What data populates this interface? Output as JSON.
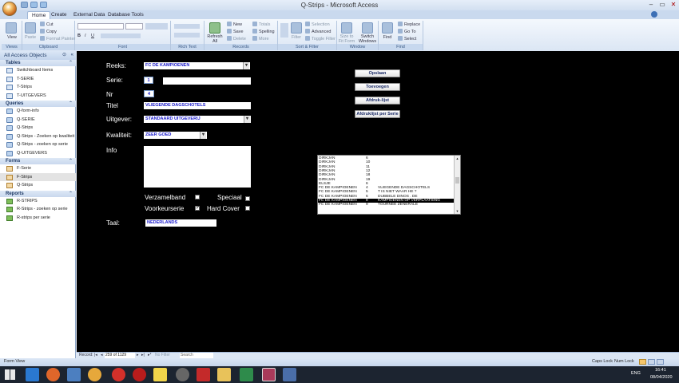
{
  "window": {
    "title": "Q-Strips - Microsoft Access",
    "controls": [
      "–",
      "▭",
      "✕"
    ]
  },
  "tabs": [
    "Home",
    "Create",
    "External Data",
    "Database Tools"
  ],
  "ribbon": {
    "groups": [
      {
        "label": "Views",
        "buttons": [
          "View"
        ]
      },
      {
        "label": "Clipboard",
        "buttons": [
          "Paste",
          "Cut",
          "Copy",
          "Format Painter"
        ]
      },
      {
        "label": "Font",
        "buttons": []
      },
      {
        "label": "Rich Text",
        "buttons": []
      },
      {
        "label": "Records",
        "buttons": [
          "Refresh All",
          "New",
          "Save",
          "Delete",
          "Totals",
          "Spelling",
          "More"
        ]
      },
      {
        "label": "Sort & Filter",
        "buttons": [
          "Filter",
          "Selection",
          "Advanced",
          "Toggle Filter"
        ]
      },
      {
        "label": "Window",
        "buttons": [
          "Size to Fit Form",
          "Switch Windows"
        ]
      },
      {
        "label": "Find",
        "buttons": [
          "Find",
          "Replace",
          "Go To",
          "Select"
        ]
      }
    ]
  },
  "nav": {
    "header": "All Access Objects",
    "sections": [
      {
        "title": "Tables",
        "type": "table",
        "items": [
          "Switchboard Items",
          "T-SERIE",
          "T-Strips",
          "T-UITGEVERS"
        ]
      },
      {
        "title": "Queries",
        "type": "query",
        "items": [
          "Q-form-info",
          "Q-SERIE",
          "Q-Strips",
          "Q-Strips - Zoeken op kwaliteit",
          "Q-Strips - zoeken op serie",
          "Q-UITGEVERS"
        ]
      },
      {
        "title": "Forms",
        "type": "form",
        "items": [
          "F-Serie",
          "F-Strips",
          "Q-Strips"
        ]
      },
      {
        "title": "Reports",
        "type": "report",
        "items": [
          "R-STRIPS",
          "R-Strips - zoeken op serie",
          "R-strips per serie"
        ]
      }
    ],
    "selected": "F-Strips"
  },
  "form": {
    "labels": {
      "reeks": "Reeks:",
      "serie": "Serie:",
      "nr": "Nr",
      "titel": "Titel",
      "uitgever": "Uitgever:",
      "kwaliteit": "Kwaliteit:",
      "info": "Info",
      "verzamelband": "Verzamelband",
      "speciaal": "Speciaal",
      "voorkeurserie": "Voorkeurserie",
      "hardcover": "Hard Cover",
      "taal": "Taal:"
    },
    "values": {
      "reeks": "FC DE KAMPIOENEN",
      "serie": "1",
      "nr": "4",
      "titel": "VLIEGENDE DAGSCHOTELS",
      "uitgever": "STANDAARD UITGEVERIJ",
      "kwaliteit": "ZEER GOED",
      "info": "",
      "taal": "NEDERLANDS",
      "verzamelband": false,
      "speciaal": false,
      "voorkeurserie": true,
      "hardcover": false
    },
    "buttons": [
      "Opslaan",
      "Toevoegen",
      "Afdruk-lijst",
      "Afdruklijst per Serie"
    ]
  },
  "listbox": {
    "rows": [
      [
        "DIRKJAN",
        "6",
        ""
      ],
      [
        "DIRKJAN",
        "10",
        ""
      ],
      [
        "DIRKJAN",
        "11",
        ""
      ],
      [
        "DIRKJAN",
        "12",
        ""
      ],
      [
        "DIRKJAN",
        "18",
        ""
      ],
      [
        "DIRKJAN",
        "19",
        ""
      ],
      [
        "ELSJE",
        "6",
        ""
      ],
      [
        "FC DE KAMPIOENEN",
        "4",
        "VLIEGENDE DAGSCHOTELS"
      ],
      [
        "FC DE KAMPIOENEN",
        "5",
        "T IS NIET WAAR HE ?"
      ],
      [
        "FC DE KAMPIOENEN",
        "6",
        "DUBBELE DINOS . DE"
      ],
      [
        "FC DE KAMPIOENEN",
        "8",
        "KAMPIOENEN OP VERPLAATSING"
      ],
      [
        "FC DE KAMPIOENEN",
        "9",
        "TOURNEE ZENERALE"
      ]
    ],
    "selected_index": 10
  },
  "record_nav": {
    "label": "Record:",
    "position": "259 of 1129",
    "filter": "No Filter",
    "search": "Search"
  },
  "status": {
    "left": "Form View",
    "caps": "Caps Lock",
    "num": "Num Lock"
  },
  "taskbar": {
    "lang": "ENG",
    "time": "16:41",
    "date": "08/04/2020"
  }
}
